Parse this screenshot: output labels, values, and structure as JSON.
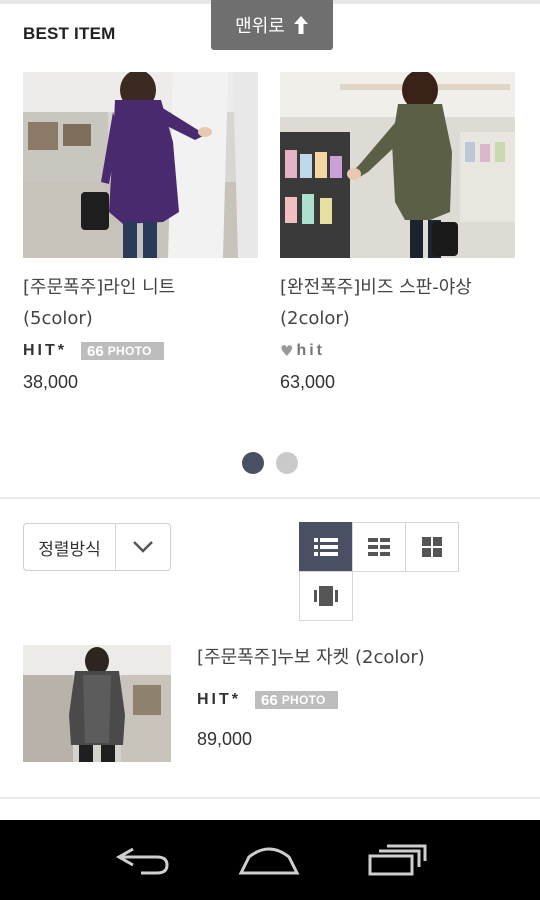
{
  "header": {
    "section_title": "BEST ITEM",
    "to_top_label": "맨위로"
  },
  "best_items": [
    {
      "name_line1": "[주문폭주]라인 니트",
      "name_line2": "(5color)",
      "badge": "HIT*",
      "photo_count": "66",
      "photo_label": "PHOTO",
      "price": "38,000"
    },
    {
      "name_line1": "[완전폭주]비즈 스판-야상",
      "name_line2": "(2color)",
      "badge": "hit",
      "price": "63,000"
    }
  ],
  "carousel": {
    "pages": 2,
    "active_page": 1
  },
  "toolbar": {
    "sort_label": "정렬방식",
    "views": [
      "list-view",
      "grid-2-view",
      "grid-4-view",
      "single-view"
    ],
    "active_view": "list-view"
  },
  "list_items": [
    {
      "name": "[주문폭주]누보 자켓 (2color)",
      "badge": "HIT*",
      "photo_count": "66",
      "photo_label": "PHOTO",
      "price": "89,000"
    }
  ],
  "nav": {
    "icons": [
      "back-icon",
      "home-icon",
      "recent-apps-icon"
    ]
  },
  "colors": {
    "accent": "#4a5064",
    "badge_bg": "#bdbdbd",
    "to_top_bg": "#6f6f6f"
  }
}
